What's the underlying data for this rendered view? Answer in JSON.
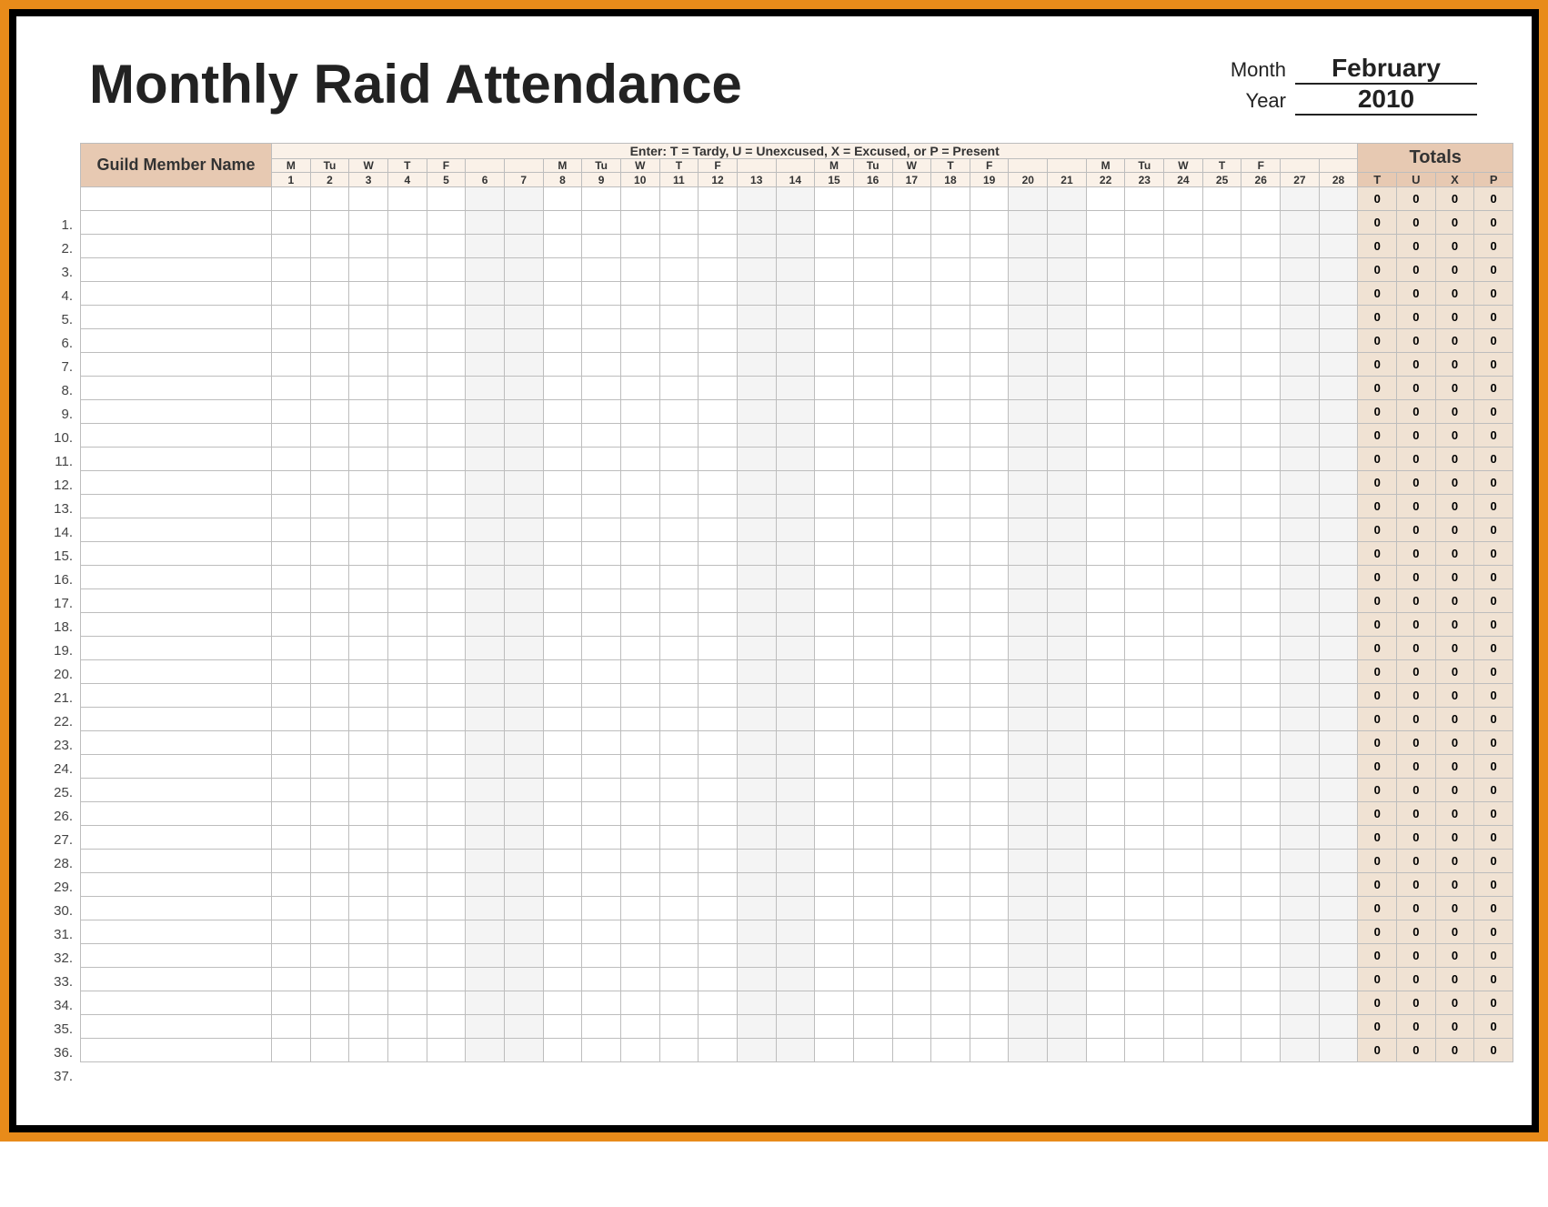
{
  "title": "Monthly Raid Attendance",
  "meta": {
    "month_label": "Month",
    "month_value": "February",
    "year_label": "Year",
    "year_value": "2010"
  },
  "legend": "Enter: T = Tardy,  U = Unexcused,  X = Excused,  or P = Present",
  "name_header": "Guild Member Name",
  "totals_header": "Totals",
  "totals_cols": [
    "T",
    "U",
    "X",
    "P"
  ],
  "days": [
    {
      "n": 1,
      "d": "M",
      "w": false
    },
    {
      "n": 2,
      "d": "Tu",
      "w": false
    },
    {
      "n": 3,
      "d": "W",
      "w": false
    },
    {
      "n": 4,
      "d": "T",
      "w": false
    },
    {
      "n": 5,
      "d": "F",
      "w": false
    },
    {
      "n": 6,
      "d": "",
      "w": true
    },
    {
      "n": 7,
      "d": "",
      "w": true
    },
    {
      "n": 8,
      "d": "M",
      "w": false
    },
    {
      "n": 9,
      "d": "Tu",
      "w": false
    },
    {
      "n": 10,
      "d": "W",
      "w": false
    },
    {
      "n": 11,
      "d": "T",
      "w": false
    },
    {
      "n": 12,
      "d": "F",
      "w": false
    },
    {
      "n": 13,
      "d": "",
      "w": true
    },
    {
      "n": 14,
      "d": "",
      "w": true
    },
    {
      "n": 15,
      "d": "M",
      "w": false
    },
    {
      "n": 16,
      "d": "Tu",
      "w": false
    },
    {
      "n": 17,
      "d": "W",
      "w": false
    },
    {
      "n": 18,
      "d": "T",
      "w": false
    },
    {
      "n": 19,
      "d": "F",
      "w": false
    },
    {
      "n": 20,
      "d": "",
      "w": true
    },
    {
      "n": 21,
      "d": "",
      "w": true
    },
    {
      "n": 22,
      "d": "M",
      "w": false
    },
    {
      "n": 23,
      "d": "Tu",
      "w": false
    },
    {
      "n": 24,
      "d": "W",
      "w": false
    },
    {
      "n": 25,
      "d": "T",
      "w": false
    },
    {
      "n": 26,
      "d": "F",
      "w": false
    },
    {
      "n": 27,
      "d": "",
      "w": true
    },
    {
      "n": 28,
      "d": "",
      "w": true
    }
  ],
  "num_rows": 37,
  "totals_default": [
    0,
    0,
    0,
    0
  ]
}
